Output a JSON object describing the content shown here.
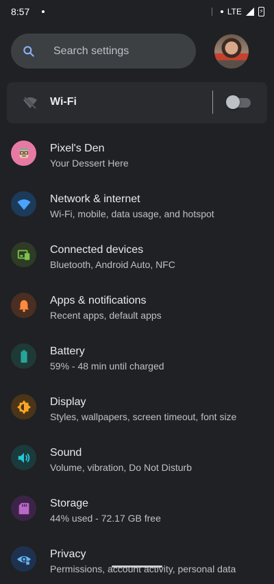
{
  "status_bar": {
    "time": "8:57",
    "network": "LTE",
    "icons": [
      "notification-dot",
      "signal-icon",
      "battery-charging-icon"
    ]
  },
  "search": {
    "placeholder": "Search settings",
    "icon": "search-icon"
  },
  "wifi_card": {
    "label": "Wi-Fi",
    "icon": "wifi-off-icon",
    "toggle_on": false
  },
  "settings": [
    {
      "title": "Pixel's Den",
      "subtitle": "Your Dessert Here",
      "icon": "pixel-den-icon",
      "icon_bg": "#e77aa4",
      "icon_fg": "#ffffff"
    },
    {
      "title": "Network & internet",
      "subtitle": "Wi-Fi, mobile, data usage, and hotspot",
      "icon": "wifi-icon",
      "icon_bg": "#1c3a5a",
      "icon_fg": "#4aa3ff"
    },
    {
      "title": "Connected devices",
      "subtitle": "Bluetooth, Android Auto, NFC",
      "icon": "devices-icon",
      "icon_bg": "#2e3b25",
      "icon_fg": "#7cc34a"
    },
    {
      "title": "Apps & notifications",
      "subtitle": "Recent apps, default apps",
      "icon": "bell-icon",
      "icon_bg": "#4a2e22",
      "icon_fg": "#ff8a3d"
    },
    {
      "title": "Battery",
      "subtitle": "59% - 48 min until charged",
      "icon": "battery-icon",
      "icon_bg": "#1f3a36",
      "icon_fg": "#26a69a"
    },
    {
      "title": "Display",
      "subtitle": "Styles, wallpapers, screen timeout, font size",
      "icon": "brightness-icon",
      "icon_bg": "#4a3518",
      "icon_fg": "#ffa726"
    },
    {
      "title": "Sound",
      "subtitle": "Volume, vibration, Do Not Disturb",
      "icon": "volume-icon",
      "icon_bg": "#1b3a3b",
      "icon_fg": "#26c6da"
    },
    {
      "title": "Storage",
      "subtitle": "44% used - 72.17 GB free",
      "icon": "storage-icon",
      "icon_bg": "#3b2447",
      "icon_fg": "#ba68c8"
    },
    {
      "title": "Privacy",
      "subtitle": "Permissions, account activity, personal data",
      "icon": "privacy-eye-icon",
      "icon_bg": "#1e3250",
      "icon_fg": "#64b5f6"
    }
  ]
}
